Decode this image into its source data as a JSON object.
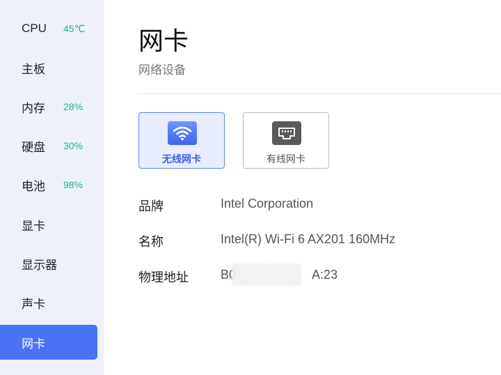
{
  "sidebar": {
    "items": [
      {
        "label": "CPU",
        "badge": "45℃"
      },
      {
        "label": "主板",
        "badge": ""
      },
      {
        "label": "内存",
        "badge": "28%"
      },
      {
        "label": "硬盘",
        "badge": "30%"
      },
      {
        "label": "电池",
        "badge": "98%"
      },
      {
        "label": "显卡",
        "badge": ""
      },
      {
        "label": "显示器",
        "badge": ""
      },
      {
        "label": "声卡",
        "badge": ""
      },
      {
        "label": "网卡",
        "badge": "",
        "active": true
      }
    ]
  },
  "header": {
    "title": "网卡",
    "subtitle": "网络设备"
  },
  "adapters": [
    {
      "label": "无线网卡",
      "icon": "wifi-icon",
      "selected": true
    },
    {
      "label": "有线网卡",
      "icon": "ethernet-port-icon",
      "selected": false
    }
  ],
  "details": [
    {
      "label": "品牌",
      "value": "Intel Corporation"
    },
    {
      "label": "名称",
      "value": "Intel(R) Wi-Fi 6 AX201 160MHz"
    },
    {
      "label": "物理地址",
      "value": "B0                      A:23"
    }
  ],
  "colors": {
    "accent": "#4a72f5",
    "badge": "#1fb37a",
    "sidebar_bg": "#eef1fa"
  }
}
